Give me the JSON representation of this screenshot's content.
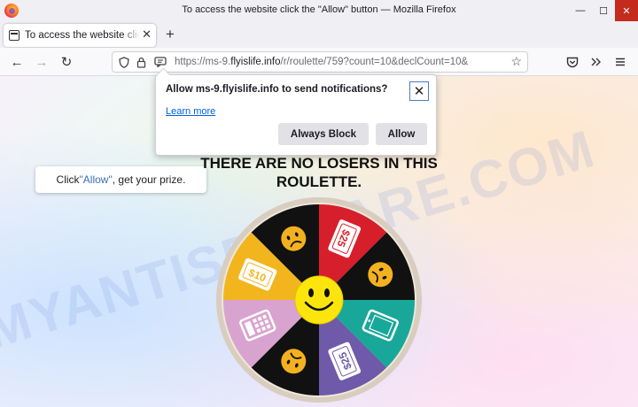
{
  "window": {
    "title": "To access the website click the \"Allow\" button — Mozilla Firefox",
    "controls": {
      "minimize": "—",
      "maximize": "☐",
      "close": "✕"
    }
  },
  "tab": {
    "label": "To access the website click the \"Allow\" button",
    "close": "✕",
    "new_tab": "+"
  },
  "nav": {
    "back": "←",
    "forward": "→",
    "reload": "↻",
    "bookmark": "☆"
  },
  "url": {
    "prefix": "https://ms-9.",
    "domain": "flyislife.info",
    "path": "/r/roulette/759?count=10&declCount=10&"
  },
  "notification": {
    "message": "Allow ms-9.flyislife.info to send notifications?",
    "learn_more": "Learn more",
    "always_block": "Always Block",
    "allow": "Allow",
    "close": "✕"
  },
  "page": {
    "headline_line1": "THERE ARE NO LOSERS IN THIS",
    "headline_line2": "ROULETTE.",
    "tip_prefix": "Click ",
    "tip_quoted": "\"Allow\"",
    "tip_suffix": ", get your prize.",
    "watermark": "MYANTISPYWARE.COM"
  },
  "wheel": {
    "segments": [
      {
        "color": "#d71f2b",
        "label": "$25",
        "kind": "ticket"
      },
      {
        "color": "#111111",
        "label": "",
        "kind": "sad"
      },
      {
        "color": "#19a79a",
        "label": "",
        "kind": "tablet"
      },
      {
        "color": "#6e5aa8",
        "label": "$25",
        "kind": "ticket"
      },
      {
        "color": "#111111",
        "label": "",
        "kind": "sad"
      },
      {
        "color": "#d9a3cf",
        "label": "",
        "kind": "calculator"
      },
      {
        "color": "#f2b51d",
        "label": "$10",
        "kind": "ticket"
      },
      {
        "color": "#111111",
        "label": "",
        "kind": "sad"
      }
    ],
    "center": "smiley"
  }
}
